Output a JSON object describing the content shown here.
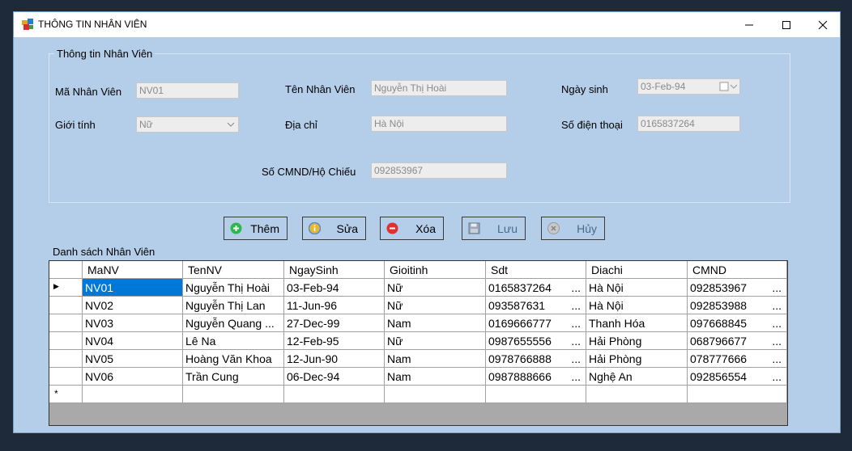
{
  "window": {
    "title": "THÔNG TIN NHÂN VIÊN",
    "minimize_icon": "minimize-icon",
    "maximize_icon": "maximize-icon",
    "close_icon": "close-icon"
  },
  "form": {
    "group_title": "Thông tin Nhân Viên",
    "ma_label": "Mã Nhân Viên",
    "ma_value": "NV01",
    "ten_label": "Tên Nhân Viên",
    "ten_value": "Nguyễn Thị Hoài",
    "ngaysinh_label": "Ngày sinh",
    "ngaysinh_value": "03-Feb-94",
    "gioitinh_label": "Giới tính",
    "gioitinh_value": "Nữ",
    "diachi_label": "Địa chỉ",
    "diachi_value": "Hà Nội",
    "sdt_label": "Số điện thoại",
    "sdt_value": "0165837264",
    "cmnd_label": "Số CMND/Hộ Chiếu",
    "cmnd_value": "092853967"
  },
  "toolbar": {
    "them": "Thêm",
    "sua": "Sửa",
    "xoa": "Xóa",
    "luu": "Lưu",
    "huy": "Hủy"
  },
  "grid": {
    "title": "Danh sách Nhân Viên",
    "columns": [
      "MaNV",
      "TenNV",
      "NgaySinh",
      "Gioitinh",
      "Sdt",
      "Diachi",
      "CMND"
    ],
    "rows": [
      [
        "NV01",
        "Nguyễn Thị Hoài",
        "03-Feb-94",
        "Nữ",
        "0165837264",
        "Hà Nội",
        "092853967"
      ],
      [
        "NV02",
        "Nguyễn Thị Lan",
        "11-Jun-96",
        "Nữ",
        "093587631",
        "Hà Nội",
        "092853988"
      ],
      [
        "NV03",
        "Nguyễn Quang ...",
        "27-Dec-99",
        "Nam",
        "0169666777",
        "Thanh Hóa",
        "097668845"
      ],
      [
        "NV04",
        "Lê Na",
        "12-Feb-95",
        "Nữ",
        "0987655556",
        "Hải Phòng",
        "068796677"
      ],
      [
        "NV05",
        "Hoàng Văn Khoa",
        "12-Jun-90",
        "Nam",
        "0978766888",
        "Hải Phòng",
        "078777666"
      ],
      [
        "NV06",
        "Trần Cung",
        "06-Dec-94",
        "Nam",
        "0987888666",
        "Nghệ An",
        "092856554"
      ]
    ],
    "ellipsis": "...",
    "new_row_marker": "*",
    "current_row_marker": "▶"
  }
}
